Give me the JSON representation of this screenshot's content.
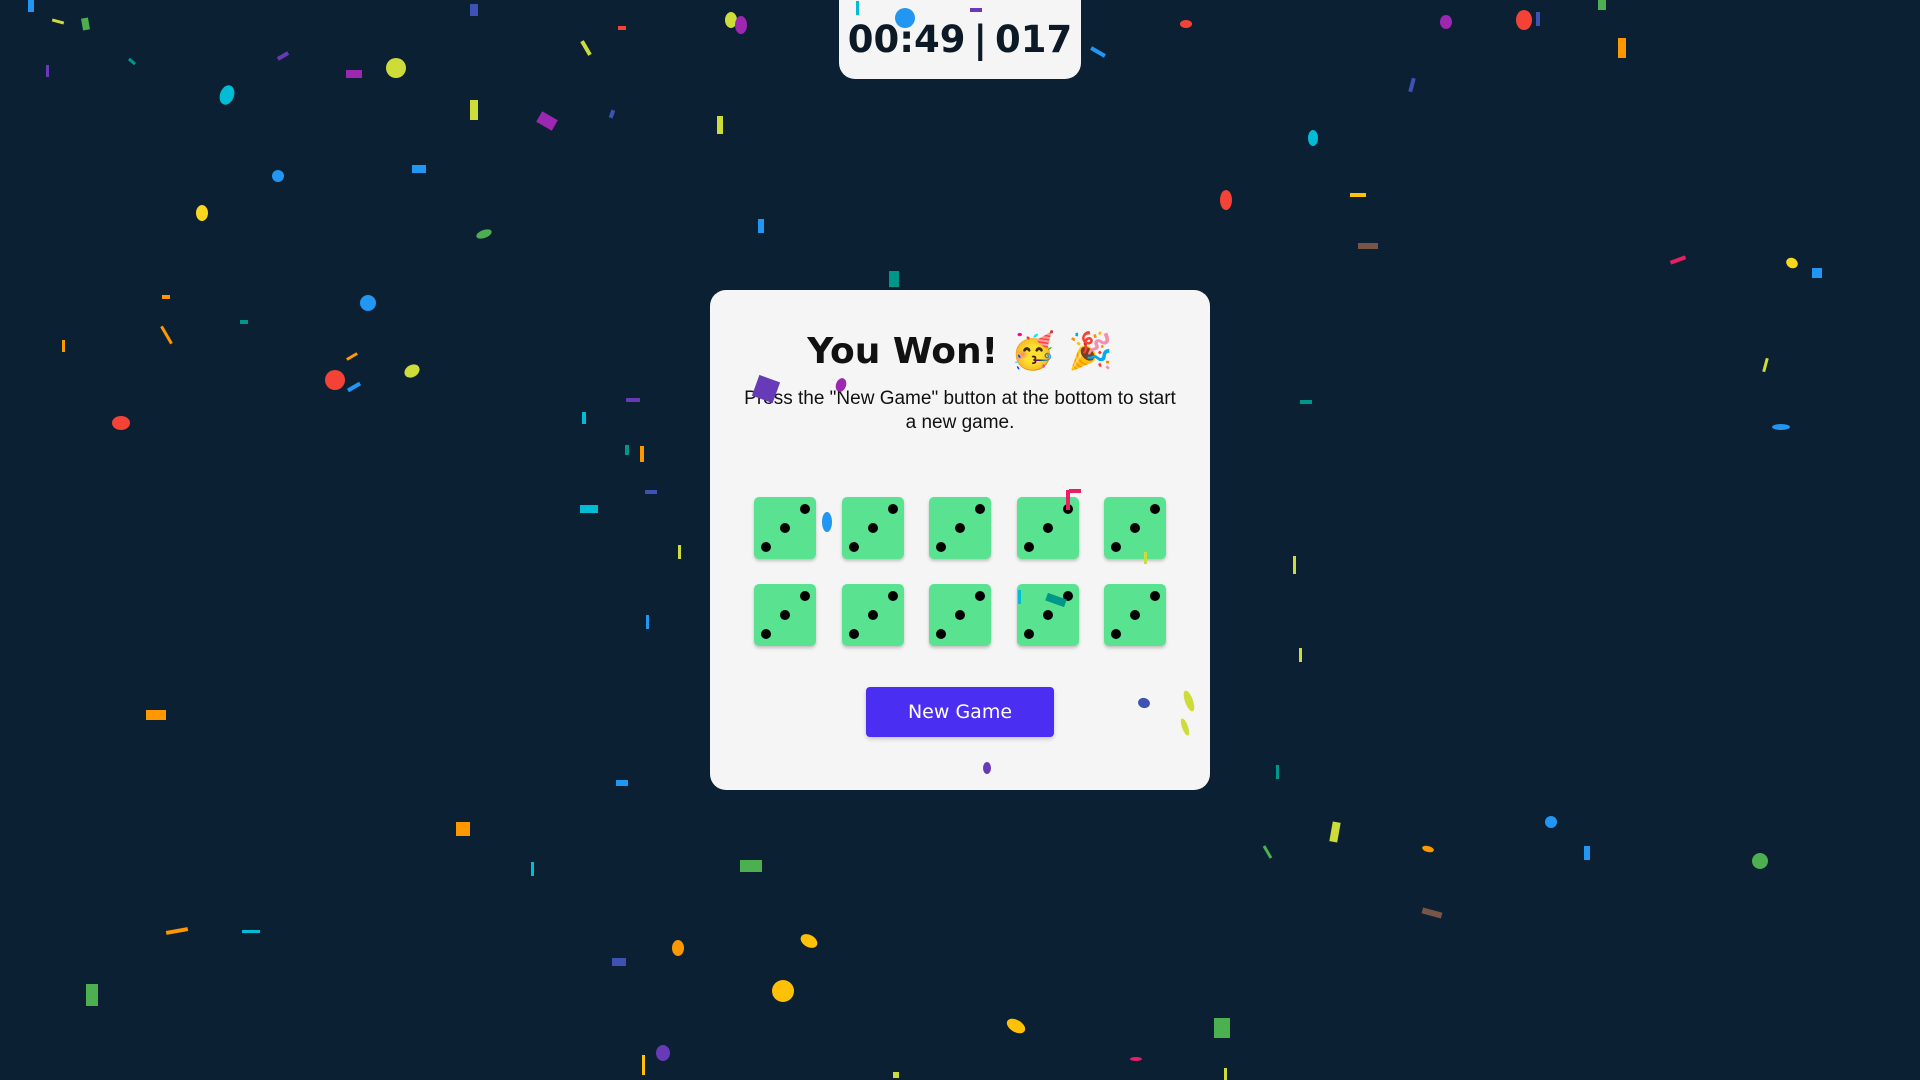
{
  "timer": {
    "time": "00:49",
    "separator": "|",
    "rolls": "017"
  },
  "card": {
    "title": "You Won! 🥳 🎉",
    "subtitle": "Press the \"New Game\" button at the bottom to start a new game.",
    "new_game_label": "New Game"
  },
  "dice": [
    {
      "value": 3,
      "held": true
    },
    {
      "value": 3,
      "held": true
    },
    {
      "value": 3,
      "held": true
    },
    {
      "value": 3,
      "held": true
    },
    {
      "value": 3,
      "held": true
    },
    {
      "value": 3,
      "held": true
    },
    {
      "value": 3,
      "held": true
    },
    {
      "value": 3,
      "held": true
    },
    {
      "value": 3,
      "held": true
    },
    {
      "value": 3,
      "held": true
    }
  ],
  "colors": {
    "background": "#0b2133",
    "panel": "#f5f5f5",
    "die_held": "#59e391",
    "pip": "#000000",
    "button": "#4a2ef2",
    "button_text": "#ffffff",
    "confetti_palette": [
      "#f9d71c",
      "#9c27b0",
      "#2196f3",
      "#00bcd4",
      "#ff9800",
      "#f44336",
      "#4caf50",
      "#e91e63",
      "#cddc39",
      "#673ab7",
      "#009688",
      "#795548",
      "#ffc107",
      "#3f51b5"
    ]
  }
}
